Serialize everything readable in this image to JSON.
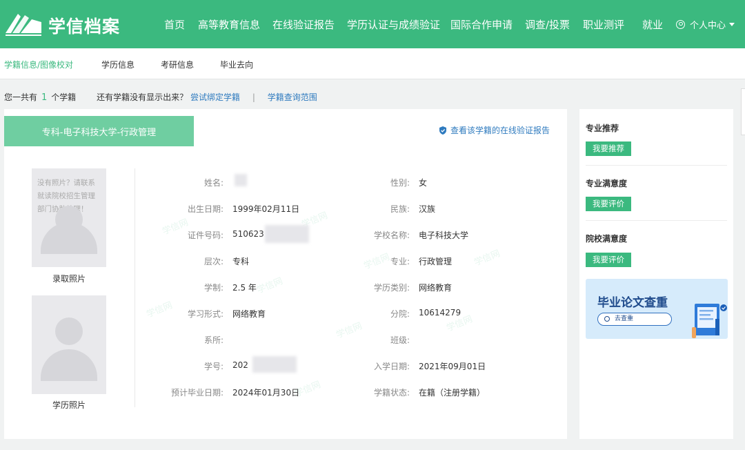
{
  "header": {
    "logo_text": "学信档案",
    "nav": [
      {
        "label": "首页"
      },
      {
        "label": "高等教育信息"
      },
      {
        "label": "在线验证报告"
      },
      {
        "label": "学历认证与成绩验证"
      },
      {
        "label": "国际合作申请"
      },
      {
        "label": "调查/投票"
      },
      {
        "label": "职业测评"
      },
      {
        "label": "就业"
      }
    ],
    "user_menu": "个人中心"
  },
  "subnav": {
    "items": [
      {
        "label": "学籍信息/图像校对"
      },
      {
        "label": "学历信息"
      },
      {
        "label": "考研信息"
      },
      {
        "label": "毕业去向"
      }
    ],
    "active_index": 0
  },
  "info_bar": {
    "prefix": "您一共有",
    "count": "1",
    "suffix": "个学籍",
    "question": "还有学籍没有显示出来？",
    "bind_link": "尝试绑定学籍",
    "divider": "|",
    "scope_link": "学籍查询范围"
  },
  "record": {
    "title": "专科-电子科技大学-行政管理",
    "verify_link": "查看该学籍的在线验证报告",
    "watermark": "学信网",
    "photos": {
      "admission_note": "没有照片？请联系就读院校招生管理部门协助处理！",
      "admission_caption": "录取照片",
      "degree_caption": "学历照片"
    },
    "fields": {
      "name": {
        "label": "姓名:",
        "value": ""
      },
      "gender": {
        "label": "性别:",
        "value": "女"
      },
      "birthdate": {
        "label": "出生日期:",
        "value": "1999年02月11日"
      },
      "ethnicity": {
        "label": "民族:",
        "value": "汉族"
      },
      "id_number": {
        "label": "证件号码:",
        "value": "510623"
      },
      "school": {
        "label": "学校名称:",
        "value": "电子科技大学"
      },
      "level": {
        "label": "层次:",
        "value": "专科"
      },
      "major": {
        "label": "专业:",
        "value": "行政管理"
      },
      "duration": {
        "label": "学制:",
        "value": "2.5 年"
      },
      "category": {
        "label": "学历类别:",
        "value": "网络教育"
      },
      "study_form": {
        "label": "学习形式:",
        "value": "网络教育"
      },
      "branch": {
        "label": "分院:",
        "value": "10614279"
      },
      "department": {
        "label": "系所:",
        "value": ""
      },
      "class": {
        "label": "班级:",
        "value": ""
      },
      "student_id": {
        "label": "学号:",
        "value": "202"
      },
      "enroll_date": {
        "label": "入学日期:",
        "value": "2021年09月01日"
      },
      "grad_date": {
        "label": "预计毕业日期:",
        "value": "2024年01月30日"
      },
      "status": {
        "label": "学籍状态:",
        "value": "在籍（注册学籍）"
      }
    }
  },
  "sidebar": {
    "sections": [
      {
        "title": "专业推荐",
        "button": "我要推荐"
      },
      {
        "title": "专业满意度",
        "button": "我要评价"
      },
      {
        "title": "院校满意度",
        "button": "我要评价"
      }
    ],
    "banner": {
      "title": "毕业论文查重",
      "button": "去查重"
    }
  },
  "colors": {
    "brand": "#3bb97f",
    "tab": "#6fcea1",
    "link": "#2f7bbf",
    "banner_bg": "#d6ebfb"
  }
}
